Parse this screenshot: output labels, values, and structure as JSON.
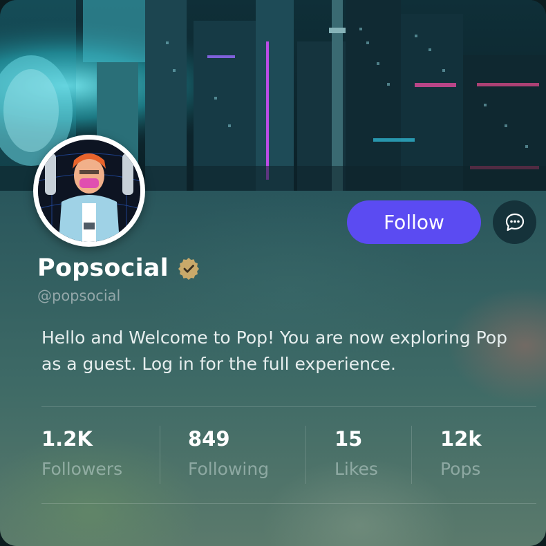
{
  "profile": {
    "name": "Popsocial",
    "handle": "@popsocial",
    "bio": "Hello and Welcome to Pop! You are now exploring Pop as a guest. Log in for the full experience.",
    "verified_icon": "verified-badge-icon",
    "cover_image": "cyberpunk-city-banner",
    "avatar_image": "cyberpunk-character-avatar"
  },
  "actions": {
    "follow_label": "Follow",
    "message_icon": "chat-bubble-icon"
  },
  "stats": [
    {
      "value": "1.2K",
      "label": "Followers"
    },
    {
      "value": "849",
      "label": "Following"
    },
    {
      "value": "15",
      "label": "Likes"
    },
    {
      "value": "12k",
      "label": "Pops"
    }
  ],
  "colors": {
    "accent": "#5b4bf2",
    "verified": "#c9a96a",
    "text_primary": "#ffffff",
    "text_muted": "#93a7a9"
  }
}
